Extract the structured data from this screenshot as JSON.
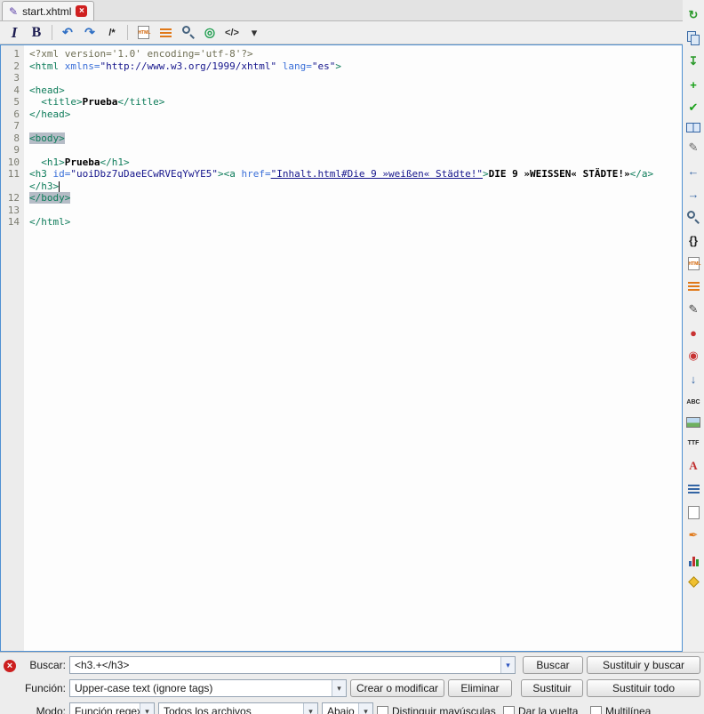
{
  "tab": {
    "file_icon": "✎",
    "title": "start.xhtml",
    "close": "×"
  },
  "toolbar": {
    "items": [
      {
        "name": "italic-button",
        "kind": "glyph",
        "glyph": "I",
        "cls": "serif-italic",
        "color": "#1c1c50"
      },
      {
        "name": "bold-button",
        "kind": "glyph",
        "glyph": "B",
        "cls": "serif-bold",
        "color": "#1c1c50"
      },
      {
        "name": "toolbar-separator",
        "kind": "sep"
      },
      {
        "name": "undo-button",
        "kind": "glyph",
        "glyph": "↶",
        "cls": "big-bold",
        "color": "#2f6fc4"
      },
      {
        "name": "redo-button",
        "kind": "glyph",
        "glyph": "↷",
        "cls": "big-bold",
        "color": "#2f6fc4"
      },
      {
        "name": "comment-button",
        "kind": "glyph",
        "glyph": "/*",
        "cls": "small-bold",
        "color": "#222222"
      },
      {
        "name": "toolbar-separator",
        "kind": "sep"
      },
      {
        "name": "insert-html-button",
        "kind": "page",
        "glyph": "HTML"
      },
      {
        "name": "numbered-list-button",
        "kind": "list",
        "color": "#e07818"
      },
      {
        "name": "preview-button",
        "kind": "mag"
      },
      {
        "name": "anchor-button",
        "kind": "glyph",
        "glyph": "◎",
        "color": "#1f9e4f",
        "cls": "big-bold"
      },
      {
        "name": "code-view-button",
        "kind": "glyph",
        "glyph": "</>",
        "cls": "small-bold",
        "color": "#333333"
      },
      {
        "name": "dropdown-caret-icon",
        "kind": "glyph",
        "glyph": "▾",
        "color": "#333333"
      }
    ]
  },
  "right_toolbar": {
    "items": [
      {
        "name": "refresh-icon",
        "kind": "glyph",
        "glyph": "↻",
        "color": "#2c9a2c",
        "cls": "big-bold"
      },
      {
        "name": "copy-icon",
        "kind": "copy"
      },
      {
        "name": "paste-icon",
        "kind": "glyph",
        "glyph": "↧",
        "color": "#2c9a2c",
        "cls": "big-bold"
      },
      {
        "name": "add-icon",
        "kind": "glyph",
        "glyph": "+",
        "color": "#18a018",
        "cls": "big-bold"
      },
      {
        "name": "validate-icon",
        "kind": "glyph",
        "glyph": "✔",
        "color": "#18a018"
      },
      {
        "name": "open-book-icon",
        "kind": "book"
      },
      {
        "name": "edit-icon",
        "kind": "glyph",
        "glyph": "✎",
        "color": "#666666"
      },
      {
        "name": "back-icon",
        "kind": "glyph",
        "glyph": "←",
        "color": "#3465a4",
        "cls": "big-bold"
      },
      {
        "name": "forward-icon",
        "kind": "glyph",
        "glyph": "→",
        "color": "#3465a4",
        "cls": "big-bold"
      },
      {
        "name": "search-icon",
        "kind": "mag"
      },
      {
        "name": "braces-icon",
        "kind": "glyph",
        "glyph": "{}",
        "cls": "small-bold",
        "color": "#222222"
      },
      {
        "name": "html-file-icon",
        "kind": "page",
        "glyph": "HTML"
      },
      {
        "name": "numbered-list-icon",
        "kind": "list",
        "color": "#e07818"
      },
      {
        "name": "pencil-icon",
        "kind": "glyph",
        "glyph": "✎",
        "color": "#444444"
      },
      {
        "name": "bug-icon",
        "kind": "glyph",
        "glyph": "●",
        "color": "#c83232"
      },
      {
        "name": "pin-icon",
        "kind": "glyph",
        "glyph": "◉",
        "color": "#c83232"
      },
      {
        "name": "arrow-down-icon",
        "kind": "glyph",
        "glyph": "↓",
        "color": "#3465a4",
        "cls": "big-bold"
      },
      {
        "name": "spellcheck-icon",
        "kind": "text",
        "glyph": "ABC",
        "color": "#222222"
      },
      {
        "name": "image-icon",
        "kind": "img"
      },
      {
        "name": "font-icon",
        "kind": "text",
        "glyph": "TTF",
        "color": "#222222"
      },
      {
        "name": "special-characters-icon",
        "kind": "glyph",
        "glyph": "A",
        "color": "#c03030",
        "cls": "serif-bold"
      },
      {
        "name": "index-icon",
        "kind": "list",
        "color": "#3465a4"
      },
      {
        "name": "clips-icon",
        "kind": "page",
        "glyph": ""
      },
      {
        "name": "pen-icon",
        "kind": "glyph",
        "glyph": "✒",
        "color": "#e07818"
      },
      {
        "name": "report-icon",
        "kind": "chart"
      },
      {
        "name": "tag-icon",
        "kind": "tag"
      }
    ]
  },
  "editor": {
    "lines": [
      {
        "n": "1",
        "seg": [
          {
            "t": "decl",
            "s": "<?xml version='1.0' encoding='utf-8'?>"
          }
        ]
      },
      {
        "n": "2",
        "seg": [
          {
            "t": "tag",
            "s": "<html"
          },
          {
            "t": "attr",
            "s": " xmlns="
          },
          {
            "t": "val",
            "s": "\"http://www.w3.org/1999/xhtml\""
          },
          {
            "t": "attr",
            "s": " lang="
          },
          {
            "t": "val",
            "s": "\"es\""
          },
          {
            "t": "tag",
            "s": ">"
          }
        ]
      },
      {
        "n": "3",
        "seg": []
      },
      {
        "n": "4",
        "seg": [
          {
            "t": "tag",
            "s": "<head>"
          }
        ]
      },
      {
        "n": "5",
        "seg": [
          {
            "t": "plain",
            "s": "  "
          },
          {
            "t": "tag",
            "s": "<title>"
          },
          {
            "t": "bold",
            "s": "Prueba"
          },
          {
            "t": "tag",
            "s": "</title>"
          }
        ]
      },
      {
        "n": "6",
        "seg": [
          {
            "t": "tag",
            "s": "</head>"
          }
        ]
      },
      {
        "n": "7",
        "seg": []
      },
      {
        "n": "8",
        "seg": [
          {
            "t": "taghl",
            "s": "<body>"
          }
        ]
      },
      {
        "n": "9",
        "seg": []
      },
      {
        "n": "10",
        "seg": [
          {
            "t": "plain",
            "s": "  "
          },
          {
            "t": "tag",
            "s": "<h1>"
          },
          {
            "t": "bold",
            "s": "Prueba"
          },
          {
            "t": "tag",
            "s": "</h1>"
          }
        ]
      },
      {
        "n": "11",
        "seg": [
          {
            "t": "tag",
            "s": "<h3"
          },
          {
            "t": "attr",
            "s": " id="
          },
          {
            "t": "val",
            "s": "\"uoiDbz7uDaeECwRVEqYwYE5\""
          },
          {
            "t": "tag",
            "s": "><a"
          },
          {
            "t": "attr",
            "s": " href="
          },
          {
            "t": "link",
            "s": "\"Inhalt.html#Die 9 »weißen« Städte!\""
          },
          {
            "t": "tag",
            "s": ">"
          },
          {
            "t": "bold",
            "s": "DIE 9 »WEISSEN« STÄDTE!»"
          },
          {
            "t": "tag",
            "s": "</a></h3>"
          },
          {
            "t": "caret",
            "s": ""
          }
        ]
      },
      {
        "n": "12",
        "seg": [
          {
            "t": "taghl",
            "s": "</body>"
          }
        ]
      },
      {
        "n": "13",
        "seg": []
      },
      {
        "n": "14",
        "seg": [
          {
            "t": "tag",
            "s": "</html>"
          }
        ]
      }
    ]
  },
  "find": {
    "search_label": "Buscar:",
    "search_value": "<h3.+</h3>",
    "find_button": "Buscar",
    "replace_find_button": "Sustituir y buscar",
    "function_label": "Función:",
    "function_value": "Upper-case text (ignore tags)",
    "create_button": "Crear o modificar",
    "delete_button": "Eliminar",
    "replace_button": "Sustituir",
    "replace_all_button": "Sustituir todo",
    "mode_label": "Modo:",
    "mode_value": "Función regex",
    "files_value": "Todos los archivos",
    "direction_value": "Abajo",
    "case_label": "Distinguir mayúsculas",
    "wrap_label": "Dar la vuelta",
    "multiline_label": "Multilínea",
    "dropdown_glyph": "▾",
    "error_glyph": "×"
  },
  "colors": {
    "focus_border": "#4f90d2",
    "tag": "#0e7c5a",
    "attribute": "#3a6fd8",
    "value": "#16168c",
    "declaration": "#6f6f55",
    "match_highlight": "#b5bcc6",
    "error_red": "#cc1f1f",
    "close_red": "#cf2020"
  }
}
